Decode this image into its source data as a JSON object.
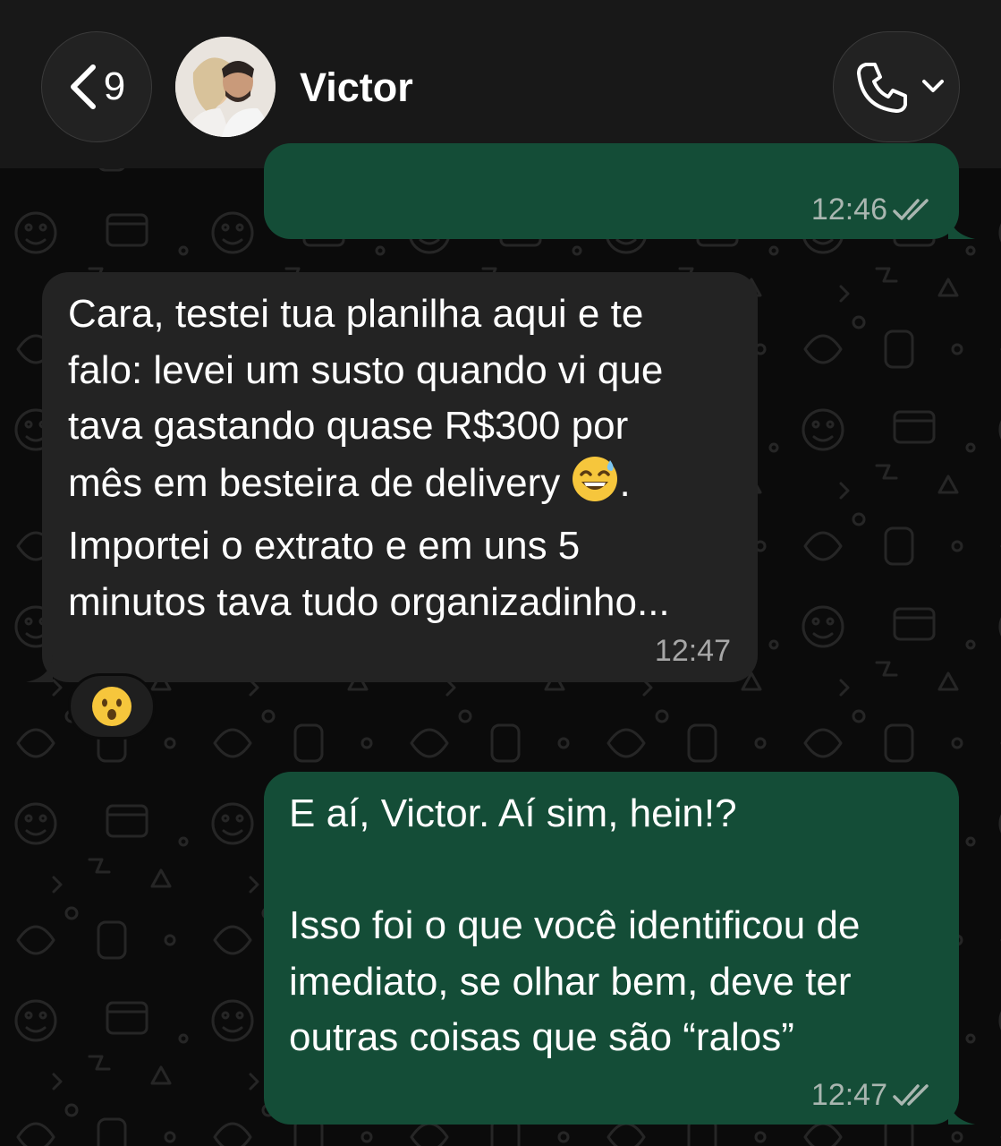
{
  "header": {
    "back_count": "9",
    "contact_name": "Victor",
    "icons": {
      "back": "chevron-left-icon",
      "call": "phone-icon",
      "dropdown": "chevron-down-icon"
    }
  },
  "messages": [
    {
      "direction": "outgoing",
      "time": "12:46",
      "status": "read",
      "text": ""
    },
    {
      "direction": "incoming",
      "text_before_emoji": "Cara, testei tua planilha aqui e te\nfalo: levei um susto quando vi que\ntava gastando quase R$300 por\nmês em besteira de delivery ",
      "emoji": "grinning-sweat-emoji",
      "text_after_emoji": ".\nImportei o extrato e em uns 5\nminutos tava tudo organizadinho...",
      "time": "12:47",
      "reaction": "hushed-face-emoji"
    },
    {
      "direction": "outgoing",
      "text": "E aí, Victor. Aí sim, hein!?\n\nIsso foi o que você identificou de\nimediato, se olhar bem, deve ter\noutras coisas que são “ralos”",
      "time": "12:47",
      "status": "read"
    }
  ],
  "colors": {
    "outgoing_bubble": "#144d37",
    "incoming_bubble": "#232323",
    "background": "#0b0b0b",
    "header": "#181818",
    "read_ticks": "#a9b6b0"
  }
}
